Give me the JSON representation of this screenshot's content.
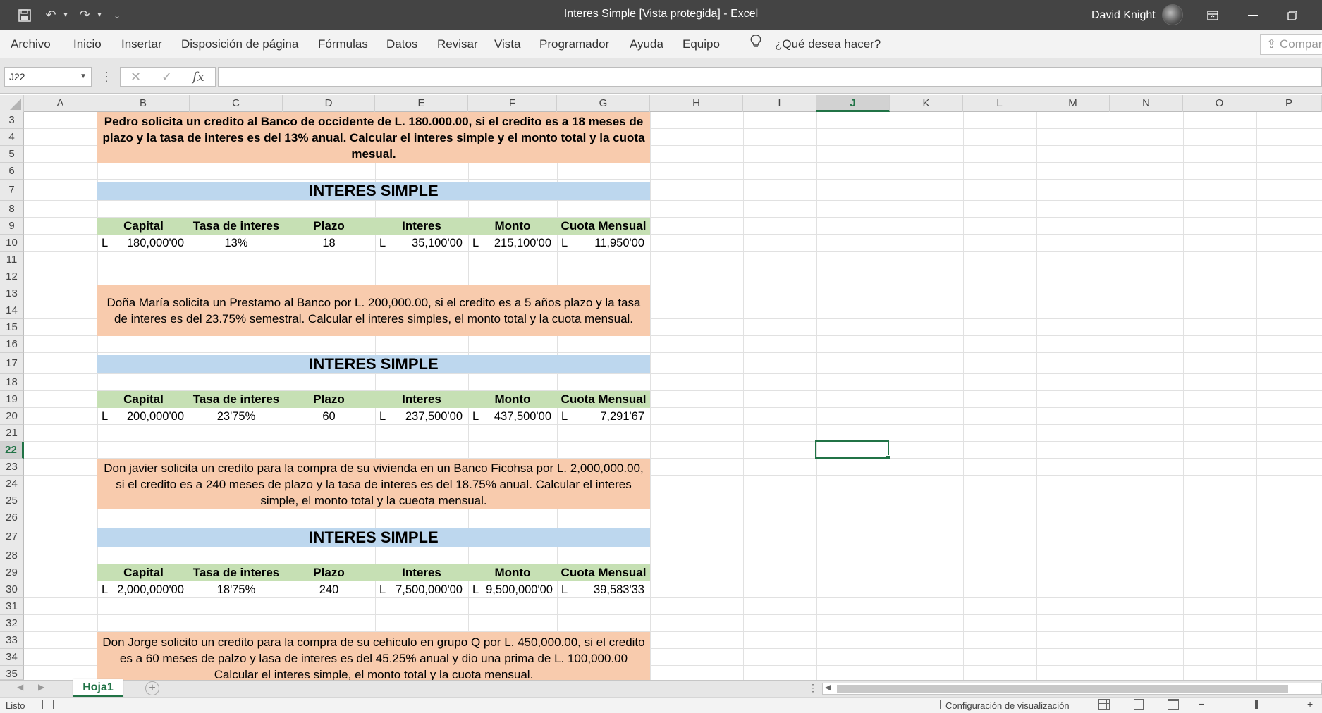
{
  "window": {
    "title": "Interes Simple  [Vista protegida]  -  Excel",
    "user": "David Knight"
  },
  "ribbon": {
    "tabs": [
      "Archivo",
      "Inicio",
      "Insertar",
      "Disposición de página",
      "Fórmulas",
      "Datos",
      "Revisar",
      "Vista",
      "Programador",
      "Ayuda",
      "Equipo"
    ],
    "tell_me": "¿Qué desea hacer?",
    "share": "Compartir"
  },
  "formula_bar": {
    "name_box": "J22",
    "formula": ""
  },
  "grid": {
    "columns": [
      "A",
      "B",
      "C",
      "D",
      "E",
      "F",
      "G",
      "H",
      "I",
      "J",
      "K",
      "L",
      "M",
      "N",
      "O",
      "P"
    ],
    "rows": [
      "3",
      "4",
      "5",
      "6",
      "7",
      "8",
      "9",
      "10",
      "11",
      "12",
      "13",
      "14",
      "15",
      "16",
      "17",
      "18",
      "19",
      "20",
      "21",
      "22",
      "23",
      "24",
      "25",
      "26",
      "27",
      "28",
      "29",
      "30",
      "31",
      "32",
      "33",
      "34",
      "35"
    ],
    "selected_column": "J",
    "selected_row": "22",
    "table_headers": [
      "Capital",
      "Tasa de interes",
      "Plazo",
      "Interes",
      "Monto",
      "Cuota Mensual"
    ],
    "blocks": [
      {
        "problem": "Pedro solicita un credito al Banco de occidente de L. 180.000.00, si el credito es a 18 meses de plazo y la tasa de interes es del 13% anual. Calcular el interes simple y el monto total y la cuota mesual.",
        "title": "INTERES SIMPLE",
        "values": {
          "capital": "180,000'00",
          "tasa": "13%",
          "plazo": "18",
          "interes": "35,100'00",
          "monto": "215,100'00",
          "cuota": "11,950'00"
        }
      },
      {
        "problem": "Doña María solicita un Prestamo al Banco por L. 200,000.00, si el credito es a 5 años plazo y la tasa de interes es del 23.75% semestral. Calcular el interes simples, el monto total y la cuota mensual.",
        "title": "INTERES SIMPLE",
        "values": {
          "capital": "200,000'00",
          "tasa": "23'75%",
          "plazo": "60",
          "interes": "237,500'00",
          "monto": "437,500'00",
          "cuota": "7,291'67"
        }
      },
      {
        "problem": "Don javier solicita un credito para la compra de su vivienda en un Banco Ficohsa por L. 2,000,000.00, si el credito es a 240 meses de plazo y la tasa de interes es del 18.75% anual. Calcular el interes simple, el monto total y la cueota mensual.",
        "title": "INTERES SIMPLE",
        "values": {
          "capital": "2,000,000'00",
          "tasa": "18'75%",
          "plazo": "240",
          "interes": "7,500,000'00",
          "monto": "9,500,000'00",
          "cuota": "39,583'33"
        }
      }
    ],
    "problem4": "Don Jorge solicito un credito para la compra de su cehiculo en grupo Q por  L. 450,000.00, si el credito es a 60 meses de palzo y lasa de interes es del 45.25% anual y dio una prima de L. 100,000.00 Calcular el interes simple, el monto total y la cuota mensual.",
    "currency": "L"
  },
  "sheets": [
    "Hoja1"
  ],
  "status": {
    "ready": "Listo",
    "display_settings": "Configuración de visualización"
  }
}
